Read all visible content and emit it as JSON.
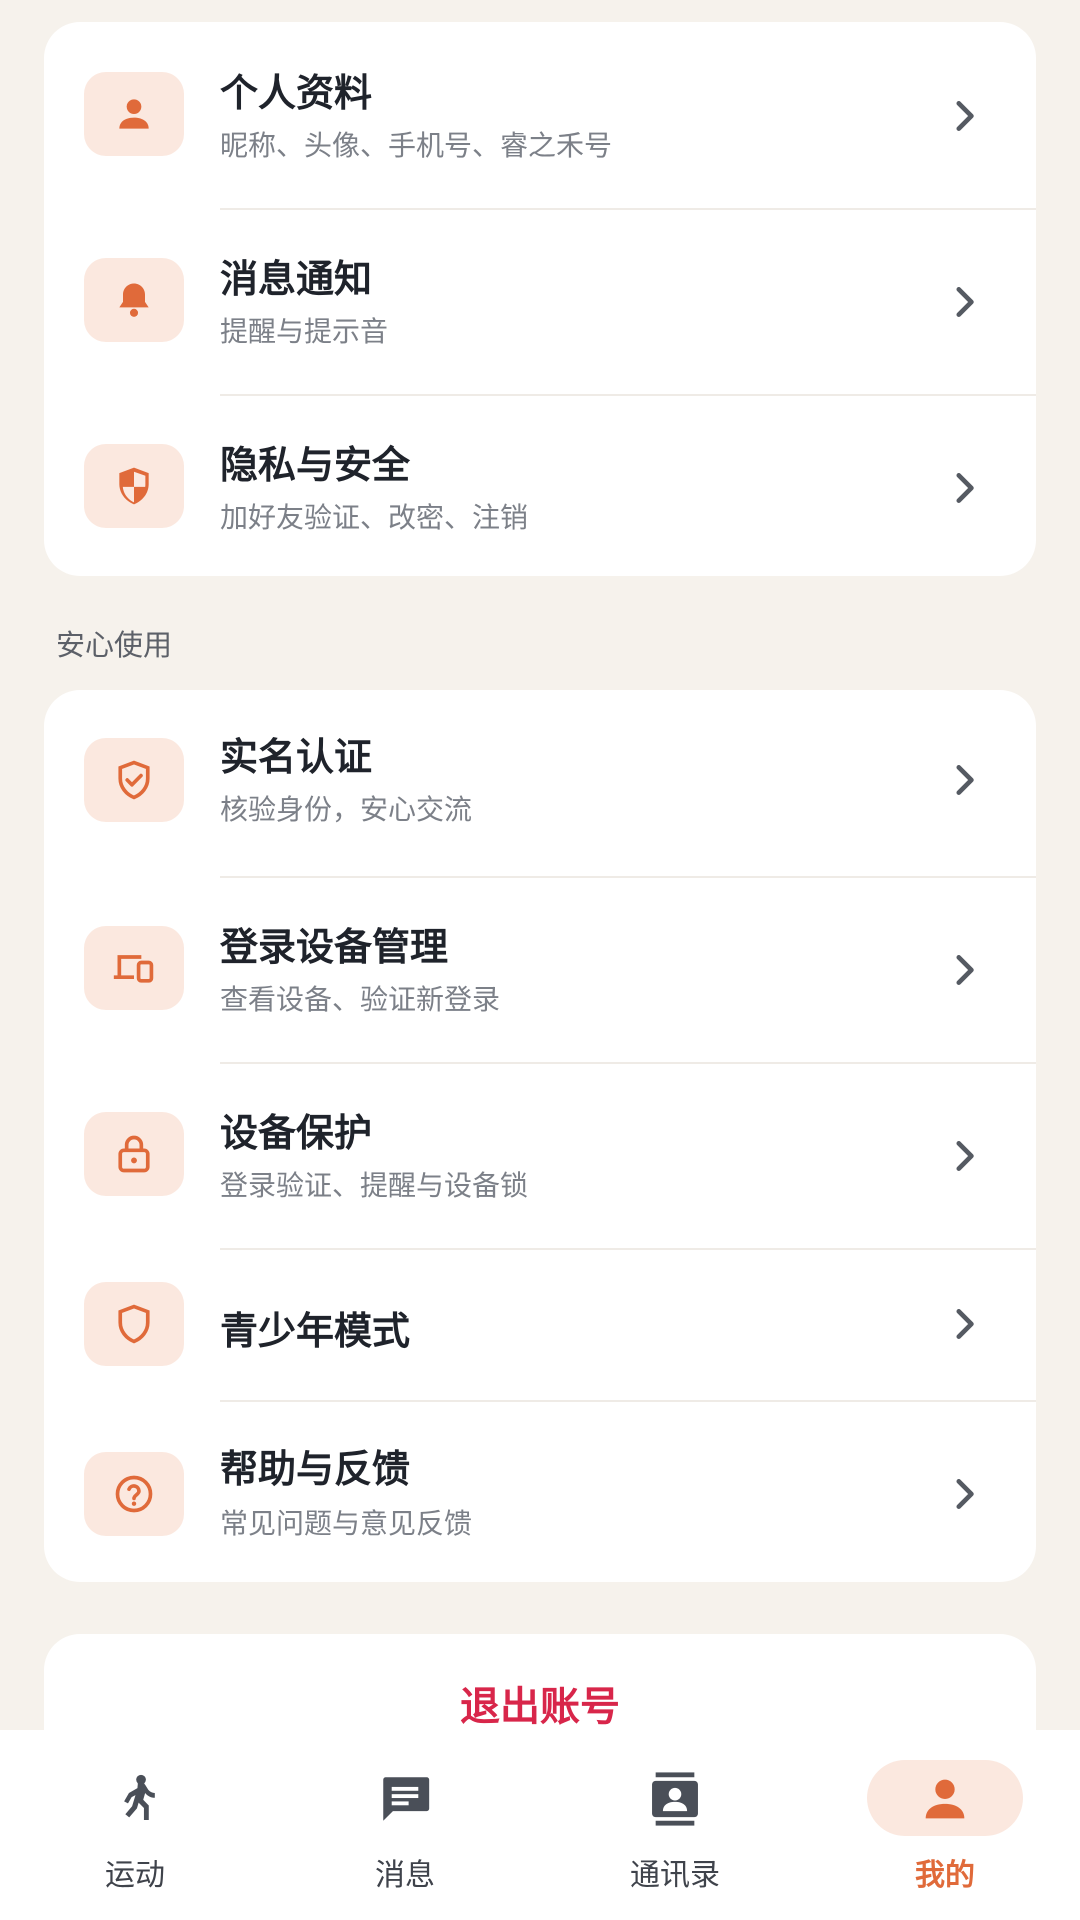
{
  "colors": {
    "background": "#f6f2ec",
    "card": "#ffffff",
    "accent": "#e06a3a",
    "icon_bg": "#fbe8df",
    "logout": "#d8264a",
    "title": "#1f232b",
    "subtitle": "#7c8088"
  },
  "account_settings": [
    {
      "title": "个人资料",
      "subtitle": "昵称、头像、手机号、睿之禾号",
      "icon": "person-icon"
    },
    {
      "title": "消息通知",
      "subtitle": "提醒与提示音",
      "icon": "bell-icon"
    },
    {
      "title": "隐私与安全",
      "subtitle": "加好友验证、改密、注销",
      "icon": "shield-half-icon"
    }
  ],
  "safe_use": {
    "section_label": "安心使用",
    "items": [
      {
        "title": "实名认证",
        "subtitle": "核验身份，安心交流",
        "icon": "shield-check-icon"
      },
      {
        "title": "登录设备管理",
        "subtitle": "查看设备、验证新登录",
        "icon": "devices-icon"
      },
      {
        "title": "设备保护",
        "subtitle": "登录验证、提醒与设备锁",
        "icon": "lock-icon"
      },
      {
        "title": "青少年模式",
        "subtitle": "",
        "icon": "shield-outline-icon"
      },
      {
        "title": "帮助与反馈",
        "subtitle": "常见问题与意见反馈",
        "icon": "help-circle-icon"
      }
    ]
  },
  "logout": {
    "label": "退出账号"
  },
  "bottom_nav": {
    "items": [
      {
        "label": "运动",
        "icon": "running-icon",
        "active": false
      },
      {
        "label": "消息",
        "icon": "message-icon",
        "active": false
      },
      {
        "label": "通讯录",
        "icon": "contacts-icon",
        "active": false
      },
      {
        "label": "我的",
        "icon": "person-icon",
        "active": true
      }
    ]
  }
}
